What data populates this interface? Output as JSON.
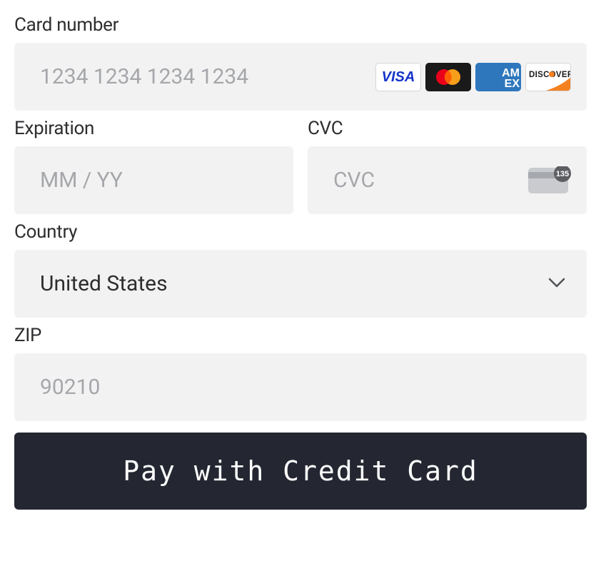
{
  "card_number": {
    "label": "Card number",
    "placeholder": "1234 1234 1234 1234",
    "value": ""
  },
  "expiration": {
    "label": "Expiration",
    "placeholder": "MM / YY",
    "value": ""
  },
  "cvc": {
    "label": "CVC",
    "placeholder": "CVC",
    "value": ""
  },
  "country": {
    "label": "Country",
    "selected": "United States"
  },
  "zip": {
    "label": "ZIP",
    "placeholder": "90210",
    "value": ""
  },
  "pay_button": "Pay with Credit Card",
  "card_brands": {
    "visa": "VISA",
    "discover": "DISCOVER",
    "amex_line1": "AM",
    "amex_line2": "EX"
  },
  "cvc_hint_digits": "135"
}
